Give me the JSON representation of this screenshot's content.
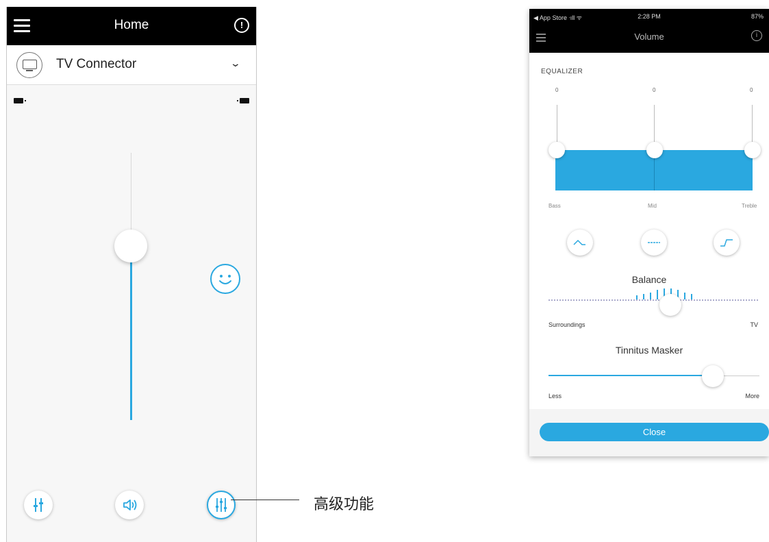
{
  "left_screen": {
    "header": {
      "title": "Home"
    },
    "device": {
      "name": "TV Connector"
    },
    "volume": {
      "level": 0.35
    },
    "callout": {
      "text": "高级功能"
    }
  },
  "right_screen": {
    "status_bar": {
      "left": "◀ App Store ᐧıll ᯤ",
      "time": "2:28 PM",
      "battery": "87%"
    },
    "header": {
      "title": "Volume"
    },
    "equalizer": {
      "label": "EQUALIZER",
      "values": [
        "0",
        "0",
        "0"
      ],
      "bands": [
        "Bass",
        "Mid",
        "Treble"
      ]
    },
    "balance": {
      "title": "Balance",
      "left_label": "Surroundings",
      "right_label": "TV"
    },
    "tinnitus": {
      "title": "Tinnitus Masker",
      "left_label": "Less",
      "right_label": "More",
      "level": 0.78
    },
    "close_label": "Close"
  },
  "colors": {
    "accent": "#2aa8e0",
    "header_bg": "#000000"
  },
  "icons": [
    "hamburger-menu-icon",
    "info-icon",
    "tv-icon",
    "chevron-down-icon",
    "battery-icon",
    "smiley-icon",
    "equalizer-icon",
    "speaker-icon",
    "advanced-sliders-icon"
  ]
}
